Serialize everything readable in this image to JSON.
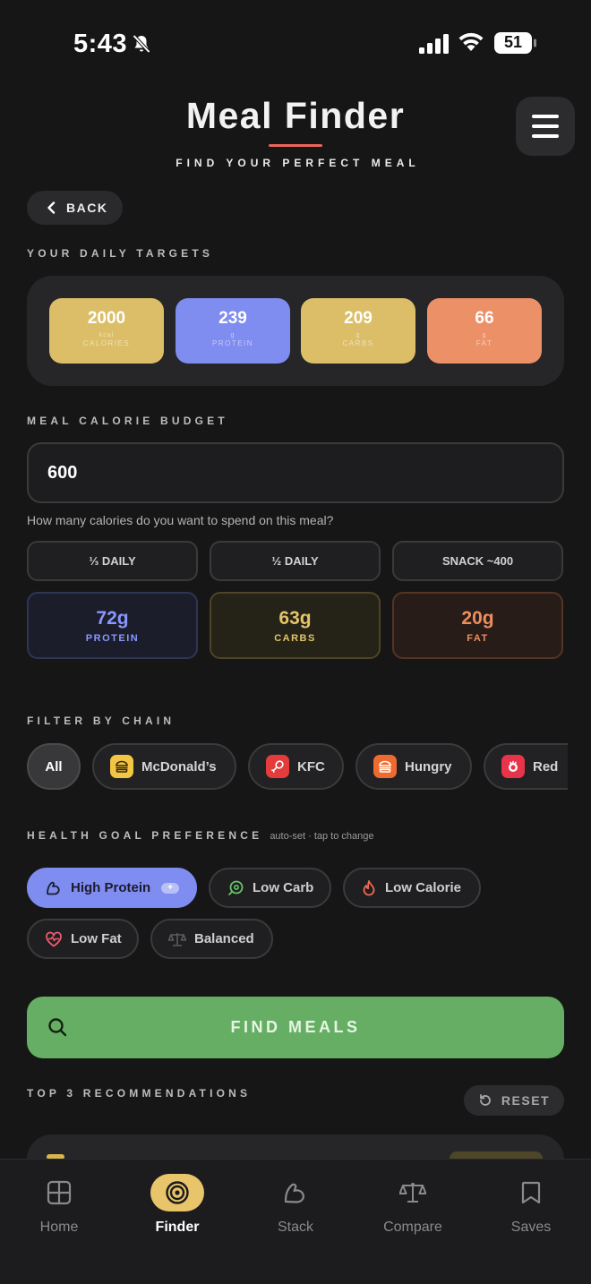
{
  "status_bar": {
    "time": "5:43",
    "battery": "51"
  },
  "header": {
    "title": "Meal Finder",
    "subtitle": "FIND YOUR PERFECT MEAL"
  },
  "back": {
    "label": "BACK"
  },
  "daily_targets": {
    "label": "YOUR DAILY TARGETS",
    "items": [
      {
        "value": "2000",
        "unit": "kcal",
        "name": "CALORIES",
        "color": "#dcbe68"
      },
      {
        "value": "239",
        "unit": "g",
        "name": "PROTEIN",
        "color": "#7f8cf0"
      },
      {
        "value": "209",
        "unit": "g",
        "name": "CARBS",
        "color": "#dcbe68"
      },
      {
        "value": "66",
        "unit": "g",
        "name": "FAT",
        "color": "#ec9068"
      }
    ]
  },
  "budget": {
    "label": "MEAL CALORIE BUDGET",
    "value": "600",
    "helper": "How many calories do you want to spend on this meal?",
    "presets": [
      "⅓ DAILY",
      "½ DAILY",
      "SNACK ~400"
    ],
    "macros": [
      {
        "value": "72g",
        "name": "PROTEIN",
        "color": "#8b97ff"
      },
      {
        "value": "63g",
        "name": "CARBS",
        "color": "#e2c46a"
      },
      {
        "value": "20g",
        "name": "FAT",
        "color": "#ef8d5e"
      }
    ]
  },
  "chains": {
    "label": "FILTER BY CHAIN",
    "items": [
      {
        "label": "All",
        "selected": true
      },
      {
        "label": "McDonald’s",
        "icon": "burger-icon",
        "color": "#f2c544"
      },
      {
        "label": "KFC",
        "icon": "drumstick-icon",
        "color": "#e43c3c"
      },
      {
        "label": "Hungry",
        "icon": "burger-icon",
        "color": "#ef6a2f"
      },
      {
        "label": "Red",
        "icon": "rooster-icon",
        "color": "#e8344a"
      }
    ]
  },
  "goals": {
    "label": "HEALTH GOAL PREFERENCE",
    "note": "auto-set · tap to change",
    "items": [
      {
        "label": "High Protein",
        "icon": "flexed-arm-icon",
        "selected": true,
        "badge": "+"
      },
      {
        "label": "Low Carb",
        "icon": "leaf-icon"
      },
      {
        "label": "Low Calorie",
        "icon": "flame-icon"
      },
      {
        "label": "Low Fat",
        "icon": "heart-pulse-icon"
      },
      {
        "label": "Balanced",
        "icon": "scale-icon"
      }
    ]
  },
  "find": {
    "label": "FIND MEALS"
  },
  "recommendations": {
    "label": "TOP 3 RECOMMENDATIONS",
    "reset_label": "RESET"
  },
  "tabs": [
    {
      "label": "Home",
      "icon": "grid-icon"
    },
    {
      "label": "Finder",
      "icon": "target-icon",
      "active": true
    },
    {
      "label": "Stack",
      "icon": "flexed-arm-icon"
    },
    {
      "label": "Compare",
      "icon": "scale-icon"
    },
    {
      "label": "Saves",
      "icon": "bookmark-icon"
    }
  ]
}
